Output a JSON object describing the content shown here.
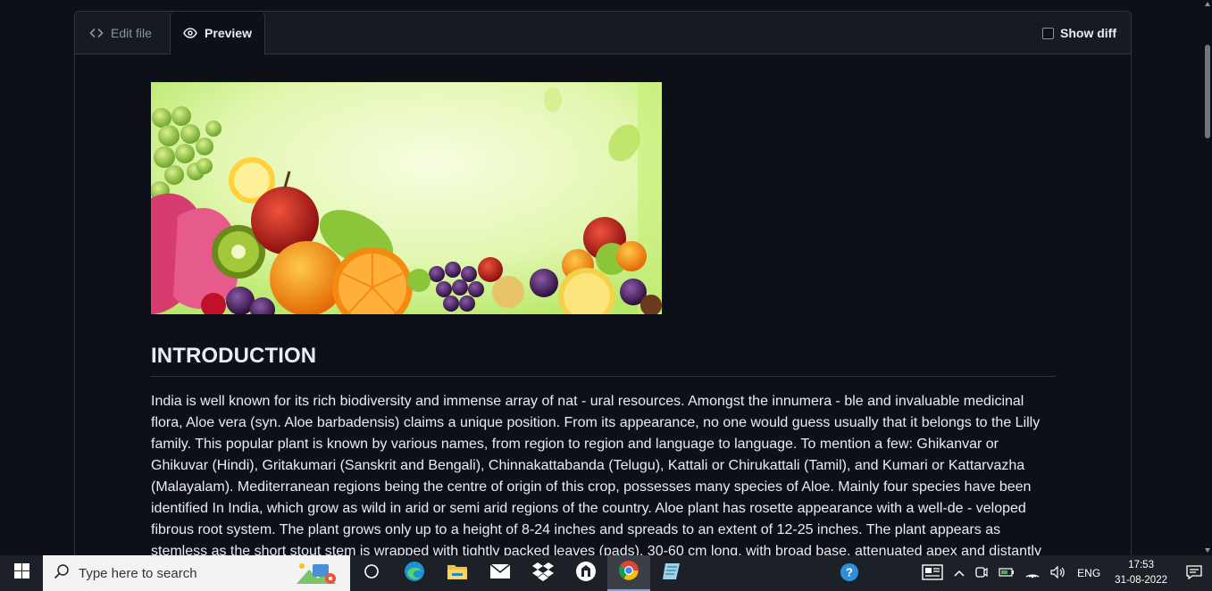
{
  "tabs": {
    "edit_label": "Edit file",
    "preview_label": "Preview",
    "show_diff_label": "Show diff"
  },
  "document": {
    "heading": "INTRODUCTION",
    "paragraph": "India is well known for its rich biodiversity and immense array of nat - ural resources. Amongst the innumera - ble and invaluable medicinal flora, Aloe vera (syn. Aloe barbadensis) claims a unique position. From its appearance, no one would guess usually that it belongs to the Lilly family. This popular plant is known by various names, from region to region and language to language. To mention a few: Ghikanvar or Ghikuvar (Hindi), Gritakumari (Sanskrit and Bengali), Chinnakattabanda (Telugu), Kattali or Chirukattali (Tamil), and Kumari or Kattarvazha (Malayalam). Mediterranean regions being the centre of origin of this crop, possesses many species of Aloe. Mainly four species have been identified In India, which grow as wild in arid or semi arid regions of the country. Aloe plant has rosette appearance with a well-de - veloped fibrous root system. The plant grows only up to a height of 8-24 inches and spreads to an extent of 12-25 inches. The plant appears as stemless as the short stout stem is wrapped with tightly packed leaves (pads), 30-60 cm long, with broad base, attenuated apex and distantly dentate"
  },
  "taskbar": {
    "search_placeholder": "Type here to search",
    "language": "ENG",
    "time": "17:53",
    "date": "31-08-2022"
  },
  "colors": {
    "background": "#0d1117",
    "tabbar": "#161b22",
    "border": "#30363d",
    "text": "#e6edf3",
    "muted": "#8b949e"
  }
}
